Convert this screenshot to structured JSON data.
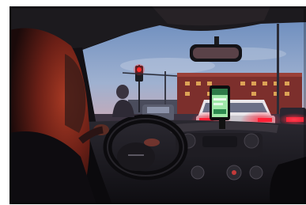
{
  "photo": {
    "scene": "photo-taxi-dashboard-night",
    "colors": {
      "sky": "#7f9fca",
      "sky_low": "#c2a6b6",
      "building": "#7c2f2c",
      "brake_light": "#ff2036",
      "traffic_light": "#ff2a2a",
      "phone_screen": "#9fe8a8",
      "hair": "#7a2418",
      "dashboard": "#17161a"
    },
    "icons": [
      "phone-mount-icon",
      "steering-wheel-icon",
      "traffic-light-icon"
    ]
  }
}
